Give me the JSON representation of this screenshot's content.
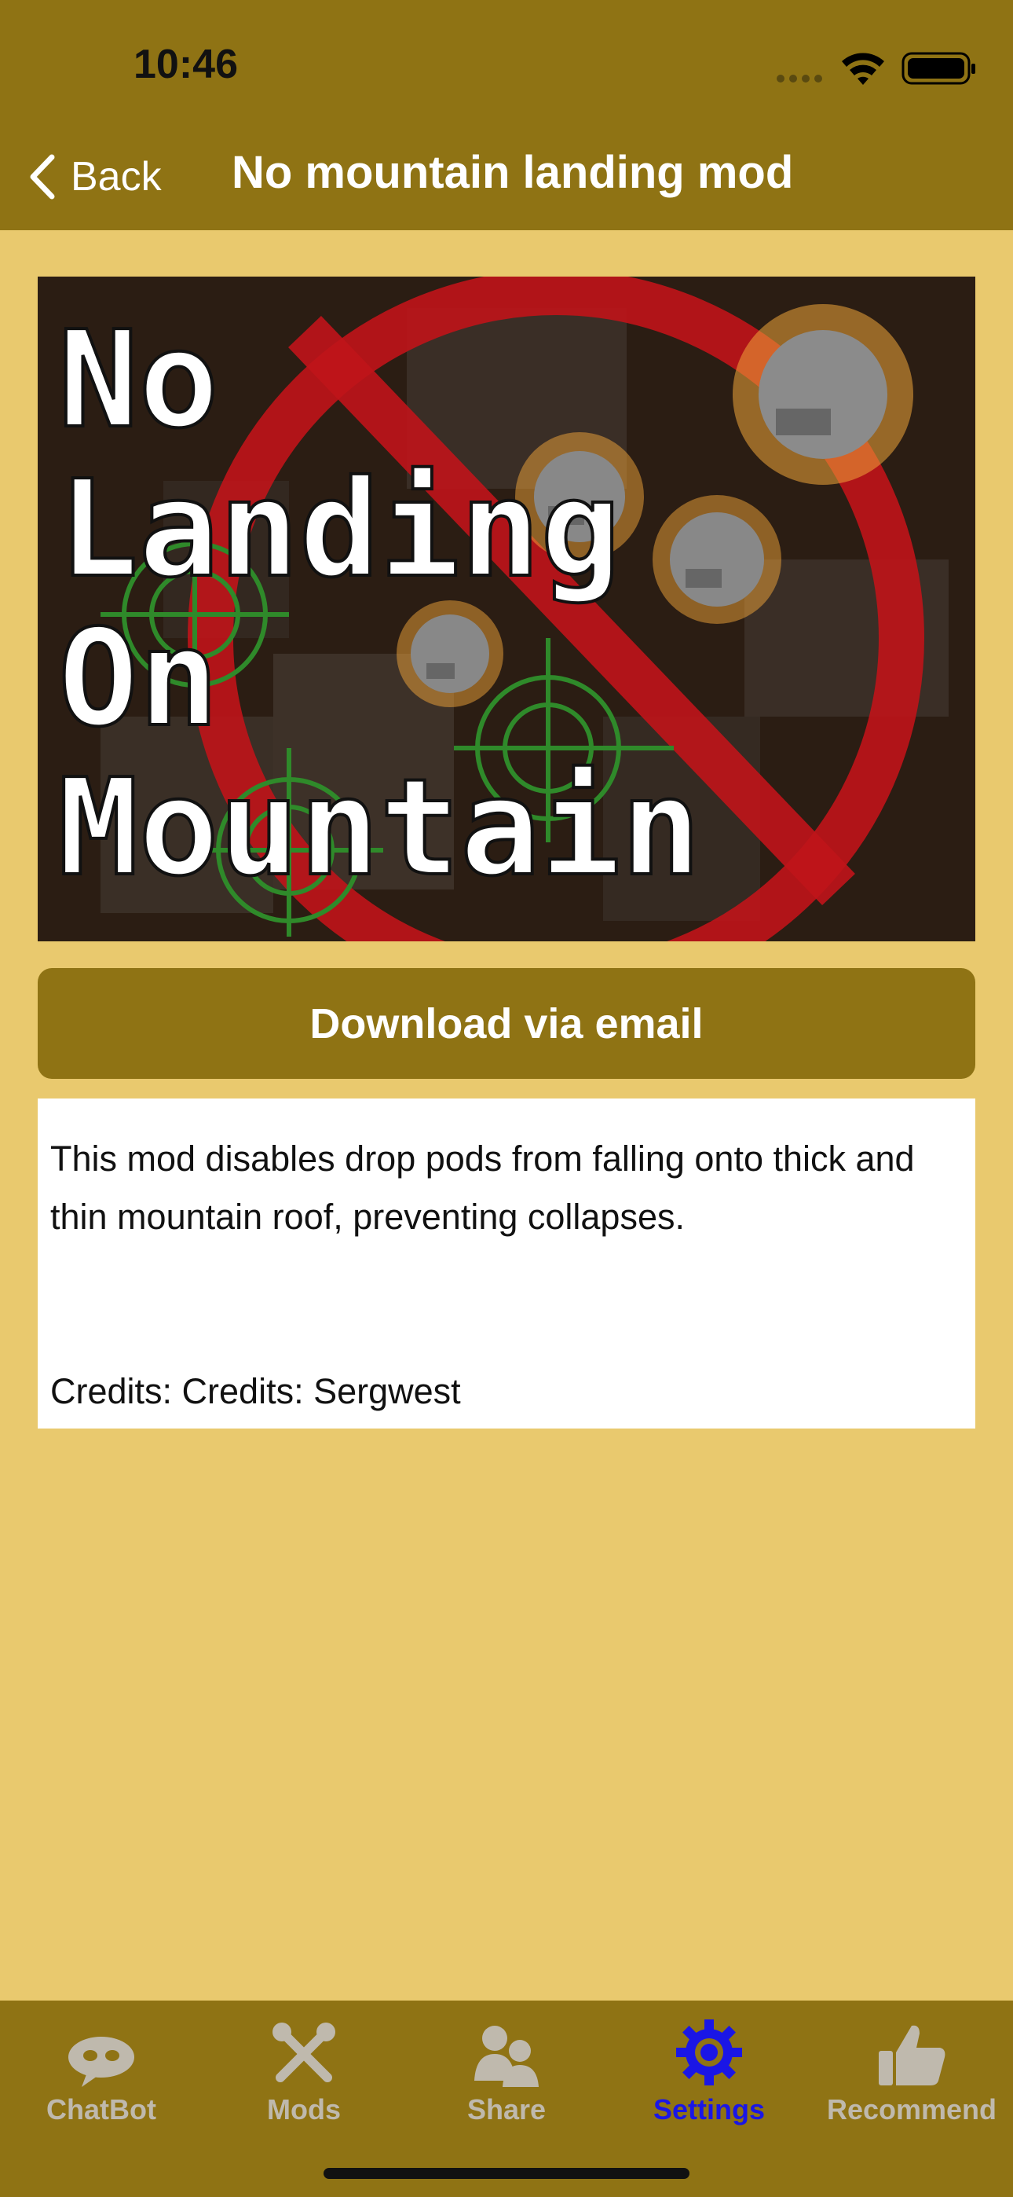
{
  "status": {
    "time": "10:46"
  },
  "nav": {
    "back_label": "Back",
    "title": "No mountain landing mod"
  },
  "hero": {
    "image_text": [
      "No",
      "Landing",
      "On",
      "Mountain"
    ]
  },
  "actions": {
    "download_label": "Download via email"
  },
  "description": {
    "body": "This mod disables drop pods from falling onto thick and thin mountain roof, preventing collapses.",
    "credits": "Credits: Credits: Sergwest"
  },
  "tabbar": {
    "tabs": [
      {
        "label": "ChatBot",
        "icon": "chatbot-icon"
      },
      {
        "label": "Mods",
        "icon": "tools-icon"
      },
      {
        "label": "Share",
        "icon": "people-icon"
      },
      {
        "label": "Settings",
        "icon": "gear-icon",
        "active": true
      },
      {
        "label": "Recommend",
        "icon": "thumbs-up-icon"
      }
    ]
  },
  "colors": {
    "bar": "#8f7314",
    "background": "#e9c96e",
    "active_tab": "#1a16e6",
    "inactive_tab": "#bfb9ad"
  }
}
